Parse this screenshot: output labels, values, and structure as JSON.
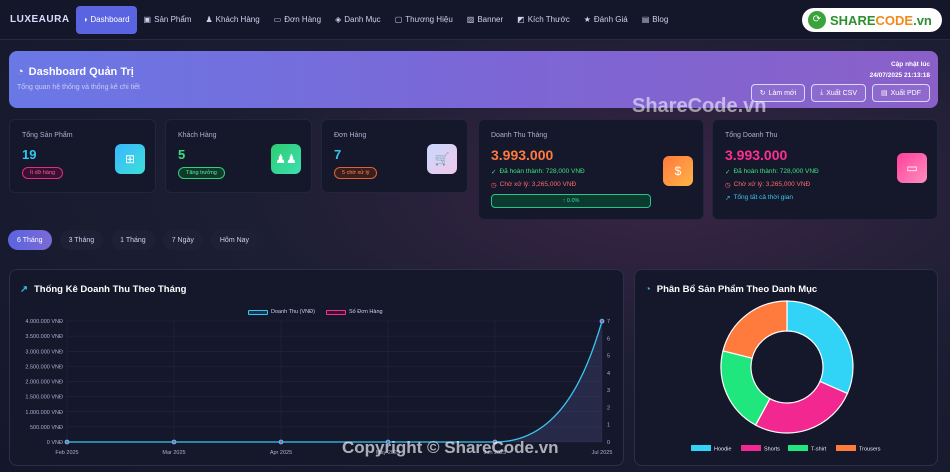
{
  "brand": "LUXEAURA",
  "nav": [
    {
      "label": "Dashboard",
      "icon": "◑",
      "name": "nav-dashboard"
    },
    {
      "label": "Sản Phẩm",
      "icon": "▣",
      "name": "nav-products"
    },
    {
      "label": "Khách Hàng",
      "icon": "♟",
      "name": "nav-customers"
    },
    {
      "label": "Đơn Hàng",
      "icon": "▭",
      "name": "nav-orders"
    },
    {
      "label": "Danh Mục",
      "icon": "◈",
      "name": "nav-categories"
    },
    {
      "label": "Thương Hiệu",
      "icon": "▢",
      "name": "nav-brands"
    },
    {
      "label": "Banner",
      "icon": "▨",
      "name": "nav-banner"
    },
    {
      "label": "Kích Thước",
      "icon": "◩",
      "name": "nav-sizes"
    },
    {
      "label": "Đánh Giá",
      "icon": "★",
      "name": "nav-reviews"
    },
    {
      "label": "Blog",
      "icon": "▤",
      "name": "nav-blog"
    }
  ],
  "watermark": {
    "logo_a": "SHARE",
    "logo_b": "CODE",
    "logo_c": ".vn",
    "mid": "ShareCode.vn",
    "bottom": "Copyright © ShareCode.vn"
  },
  "header": {
    "title": "Dashboard Quản Trị",
    "subtitle": "Tổng quan hệ thống và thống kê chi tiết",
    "update_label": "Cập nhật lúc",
    "update_time": "24/07/2025 21:13:18",
    "buttons": [
      {
        "label": "Làm mới",
        "icon": "↻"
      },
      {
        "label": "Xuất CSV",
        "icon": "⤓"
      },
      {
        "label": "Xuất PDF",
        "icon": "▤"
      }
    ]
  },
  "stats": {
    "products": {
      "label": "Tổng Sản Phẩm",
      "value": "19",
      "pill": "Ít dữ hàng"
    },
    "customers": {
      "label": "Khách Hàng",
      "value": "5",
      "pill": "Tăng trưởng"
    },
    "orders": {
      "label": "Đơn Hàng",
      "value": "7",
      "pill": "5 chờ xử lý"
    },
    "monthly": {
      "label": "Doanh Thu Tháng",
      "value": "3.993.000",
      "done": "Đã hoàn thành: 728,000 VNĐ",
      "pending": "Chờ xử lý: 3,265,000 VNĐ",
      "growth": "↑ 0.0%"
    },
    "total": {
      "label": "Tổng Doanh Thu",
      "value": "3.993.000",
      "done": "Đã hoàn thành: 728,000 VNĐ",
      "pending": "Chờ xử lý: 3,265,000 VNĐ",
      "all": "Tổng tất cả thời gian"
    }
  },
  "tabs": [
    "6 Tháng",
    "3 Tháng",
    "1 Tháng",
    "7 Ngày",
    "Hôm Nay"
  ],
  "revenue_panel": {
    "title": "Thống Kê Doanh Thu Theo Tháng"
  },
  "category_panel": {
    "title": "Phân Bổ Sản Phẩm Theo Danh Mục"
  },
  "colors": {
    "accent": "#5b64e0",
    "revenue": "#38c6f0",
    "orders": "#ff2f92",
    "hoodie": "#31d3f7",
    "shorts": "#f2278f",
    "tshirt": "#1fe67d",
    "trousers": "#ff7a3d"
  },
  "chart_data": [
    {
      "type": "line",
      "x": [
        "Feb 2025",
        "Mar 2025",
        "Apr 2025",
        "May 2025",
        "Jun 2025",
        "Jul 2025"
      ],
      "series": [
        {
          "name": "Doanh Thu (VNĐ)",
          "axis": "left",
          "values": [
            0,
            0,
            0,
            0,
            0,
            3993000
          ]
        },
        {
          "name": "Số Đơn Hàng",
          "axis": "right",
          "values": [
            0,
            0,
            0,
            0,
            0,
            7
          ]
        }
      ],
      "yticks_left": [
        "0 VNĐ",
        "500.000 VNĐ",
        "1.000.000 VNĐ",
        "1.500.000 VNĐ",
        "2.000.000 VNĐ",
        "2.500.000 VNĐ",
        "3.000.000 VNĐ",
        "3.500.000 VNĐ",
        "4.000.000 VNĐ"
      ],
      "yticks_right": [
        "0",
        "1",
        "2",
        "3",
        "4",
        "5",
        "6",
        "7"
      ],
      "ylim_left": [
        0,
        4000000
      ],
      "ylim_right": [
        0,
        7
      ],
      "legend": "top"
    },
    {
      "type": "pie",
      "donut": true,
      "categories": [
        "Hoodie",
        "Shorts",
        "T-shirt",
        "Trousers"
      ],
      "values": [
        6,
        5,
        4,
        4
      ],
      "legend": "bottom"
    }
  ]
}
